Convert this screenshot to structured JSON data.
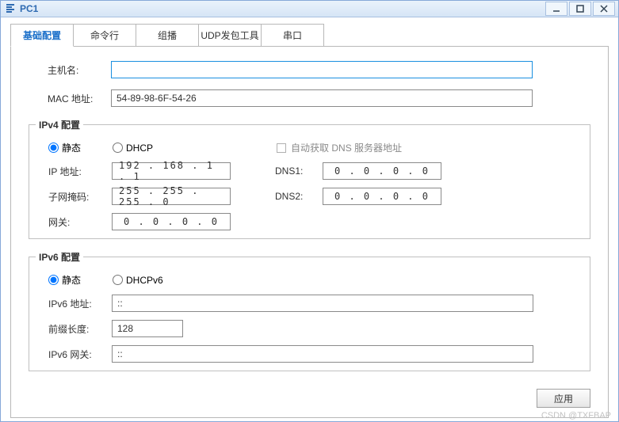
{
  "window": {
    "title": "PC1"
  },
  "tabs": [
    "基础配置",
    "命令行",
    "组播",
    "UDP发包工具",
    "串口"
  ],
  "basic": {
    "host_label": "主机名:",
    "host_value": "",
    "mac_label": "MAC 地址:",
    "mac_value": "54-89-98-6F-54-26"
  },
  "ipv4": {
    "legend": "IPv4 配置",
    "static_label": "静态",
    "dhcp_label": "DHCP",
    "auto_dns_label": "自动获取 DNS 服务器地址",
    "ip_label": "IP 地址:",
    "ip_value": "192  . 168  .  1   .  1",
    "mask_label": "子网掩码:",
    "mask_value": "255  . 255  . 255  .  0",
    "gw_label": "网关:",
    "gw_value": "0   .  0   .  0   .  0",
    "dns1_label": "DNS1:",
    "dns1_value": "0   .  0   .  0   .  0",
    "dns2_label": "DNS2:",
    "dns2_value": "0   .  0   .  0   .  0"
  },
  "ipv6": {
    "legend": "IPv6 配置",
    "static_label": "静态",
    "dhcp_label": "DHCPv6",
    "addr_label": "IPv6 地址:",
    "addr_value": "::",
    "prefix_label": "前缀长度:",
    "prefix_value": "128",
    "gw_label": "IPv6 网关:",
    "gw_value": "::"
  },
  "apply_label": "应用",
  "watermark": "CSDN @TXFBAP"
}
